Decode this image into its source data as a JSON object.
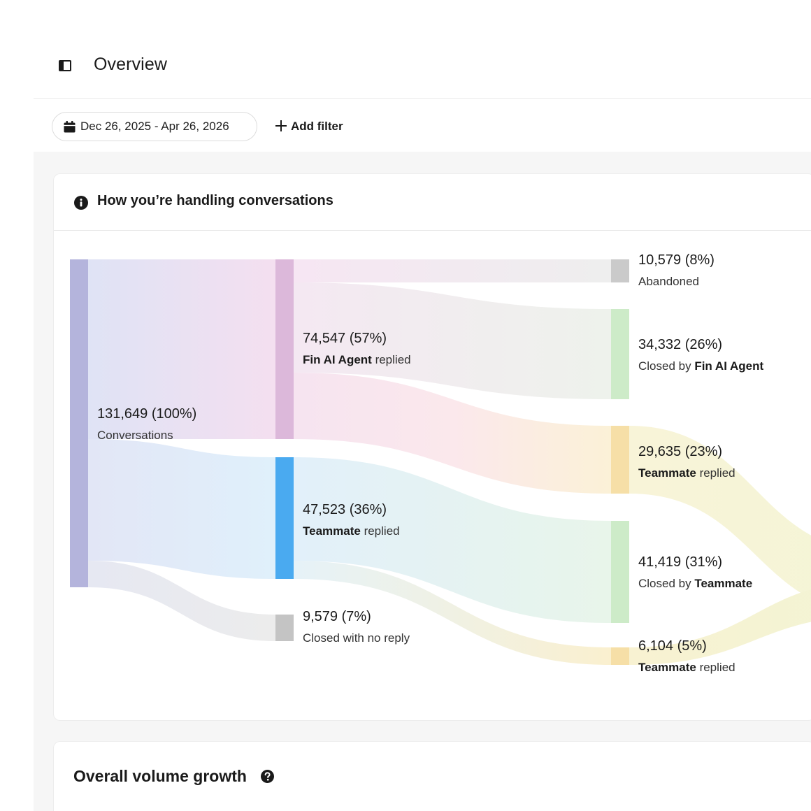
{
  "header": {
    "title": "Overview",
    "sidebar_toggle_icon": "sidebar-toggle-icon"
  },
  "toolbar": {
    "date_range": "Dec 26, 2025 - Apr 26, 2026",
    "calendar_icon": "calendar-icon",
    "add_filter_label": "Add filter",
    "add_icon": "plus-icon"
  },
  "card_flow": {
    "title": "How you’re handling conversations",
    "info_icon": "info-icon"
  },
  "card_growth": {
    "title": "Overall volume growth",
    "help_icon": "help-icon"
  },
  "colors": {
    "conversations": "#b4b4dc",
    "fin_replied": "#dcb8da",
    "teammate_replied": "#4aaaf0",
    "no_reply": "#c4c4c4",
    "abandoned": "#cacaca",
    "closed": "#cdebc8",
    "teammate_replied_out": "#f6dfa7"
  },
  "chart_data": {
    "type": "sankey",
    "nodes": [
      {
        "id": "conversations",
        "value": "131,649 (100%)",
        "prefix": "",
        "bold": "",
        "suffix": "Conversations"
      },
      {
        "id": "fin",
        "value": "74,547 (57%)",
        "prefix": "",
        "bold": "Fin AI Agent",
        "suffix": " replied"
      },
      {
        "id": "teammate",
        "value": "47,523 (36%)",
        "prefix": "",
        "bold": "Teammate",
        "suffix": " replied"
      },
      {
        "id": "noreply",
        "value": "9,579 (7%)",
        "prefix": "",
        "bold": "",
        "suffix": "Closed with no reply"
      },
      {
        "id": "abandoned",
        "value": "10,579 (8%)",
        "prefix": "",
        "bold": "",
        "suffix": "Abandoned"
      },
      {
        "id": "closed_fin",
        "value": "34,332 (26%)",
        "prefix": "Closed by ",
        "bold": "Fin AI Agent",
        "suffix": ""
      },
      {
        "id": "fin_to_teammate",
        "value": "29,635 (23%)",
        "prefix": "",
        "bold": "Teammate",
        "suffix": " replied"
      },
      {
        "id": "closed_teammate",
        "value": "41,419 (31%)",
        "prefix": "Closed by ",
        "bold": "Teammate",
        "suffix": ""
      },
      {
        "id": "teammate_to_teammate",
        "value": "6,104 (5%)",
        "prefix": "",
        "bold": "Teammate",
        "suffix": " replied"
      }
    ],
    "links": [
      {
        "source": "conversations",
        "target": "fin",
        "value": 74547
      },
      {
        "source": "conversations",
        "target": "teammate",
        "value": 47523
      },
      {
        "source": "conversations",
        "target": "noreply",
        "value": 9579
      },
      {
        "source": "fin",
        "target": "abandoned",
        "value": 10579
      },
      {
        "source": "fin",
        "target": "closed_fin",
        "value": 34332
      },
      {
        "source": "fin",
        "target": "fin_to_teammate",
        "value": 29635
      },
      {
        "source": "teammate",
        "target": "closed_teammate",
        "value": 41419
      },
      {
        "source": "teammate",
        "target": "teammate_to_teammate",
        "value": 6104
      }
    ]
  }
}
